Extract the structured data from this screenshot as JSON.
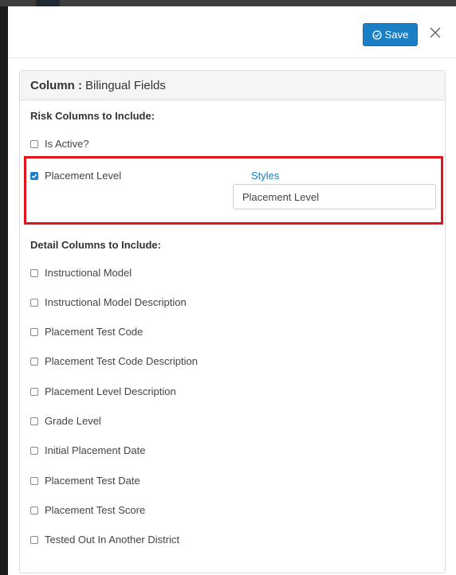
{
  "header": {
    "save_label": "Save",
    "save_icon": "check-circle-icon",
    "close_icon": "close-icon"
  },
  "card": {
    "title_prefix": "Column :",
    "title_value": "Bilingual Fields"
  },
  "risk_section": {
    "title": "Risk Columns to Include:",
    "items": [
      {
        "label": "Is Active?",
        "checked": false
      },
      {
        "label": "Placement Level",
        "checked": true
      }
    ],
    "styles_link": "Styles",
    "style_input_value": "Placement Level"
  },
  "detail_section": {
    "title": "Detail Columns to Include:",
    "items": [
      {
        "label": "Instructional Model",
        "checked": false
      },
      {
        "label": "Instructional Model Description",
        "checked": false
      },
      {
        "label": "Placement Test Code",
        "checked": false
      },
      {
        "label": "Placement Test Code Description",
        "checked": false
      },
      {
        "label": "Placement Level Description",
        "checked": false
      },
      {
        "label": "Grade Level",
        "checked": false
      },
      {
        "label": "Initial Placement Date",
        "checked": false
      },
      {
        "label": "Placement Test Date",
        "checked": false
      },
      {
        "label": "Placement Test Score",
        "checked": false
      },
      {
        "label": "Tested Out In Another District",
        "checked": false
      }
    ]
  },
  "colors": {
    "accent": "#1a7fc4",
    "highlight": "#e2141b"
  }
}
